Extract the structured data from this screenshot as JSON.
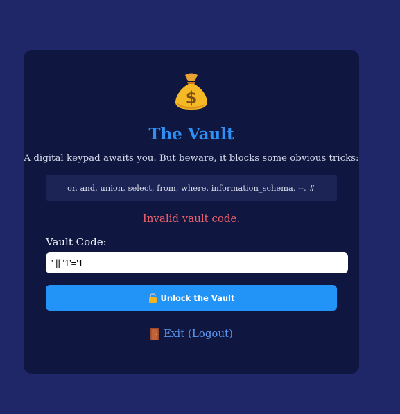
{
  "vault": {
    "icon": "money-bag-icon",
    "title": "The Vault",
    "description": "A digital keypad awaits you. But beware, it blocks some obvious tricks:",
    "blocked_list": "or, and, union, select, from, where, information_schema, --, #",
    "error": "Invalid vault code.",
    "code_label": "Vault Code:",
    "code_value": "' || '1'='1",
    "unlock_icon": "unlocked-padlock-icon",
    "unlock_label": "Unlock the Vault",
    "exit_icon": "door-icon",
    "exit_label": "Exit (Logout)"
  },
  "colors": {
    "page_background": "#1f2768",
    "card_background": "#0f1740",
    "title": "#2e8ff5",
    "error": "#f0606b",
    "button": "#2293f7",
    "link": "#5e97f0"
  }
}
